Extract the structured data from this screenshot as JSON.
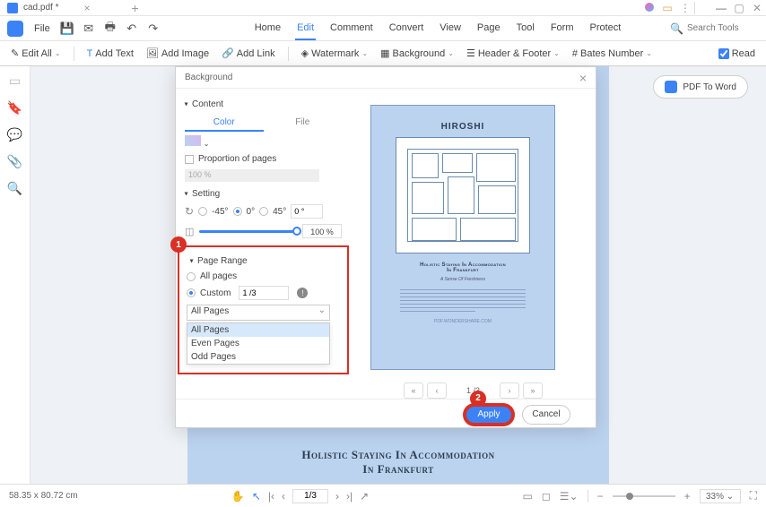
{
  "titlebar": {
    "tab_name": "cad.pdf *"
  },
  "menubar": {
    "file": "File",
    "items": [
      "Home",
      "Edit",
      "Comment",
      "Convert",
      "View",
      "Page",
      "Tool",
      "Form",
      "Protect"
    ],
    "active_index": 1,
    "search_placeholder": "Search Tools"
  },
  "toolbar": {
    "edit_all": "Edit All",
    "add_text": "Add Text",
    "add_image": "Add Image",
    "add_link": "Add Link",
    "watermark": "Watermark",
    "background": "Background",
    "header_footer": "Header & Footer",
    "bates_number": "Bates Number",
    "read": "Read"
  },
  "pdf_to_word": "PDF To Word",
  "dialog": {
    "title": "Background",
    "content": {
      "header": "Content",
      "color_tab": "Color",
      "file_tab": "File",
      "proportion_label": "Proportion of pages",
      "proportion_value": "100 %"
    },
    "setting": {
      "header": "Setting",
      "neg45": "-45°",
      "zero": "0°",
      "pos45": "45°",
      "angle_value": "0 °",
      "opacity_value": "100 %"
    },
    "page_range": {
      "header": "Page Range",
      "all_pages": "All pages",
      "custom": "Custom",
      "custom_value": "1 /3",
      "dropdown_selected": "All Pages",
      "options": [
        "All Pages",
        "Even Pages",
        "Odd Pages"
      ]
    },
    "preview": {
      "title": "HIROSHI",
      "subtitle1": "Holistic Staying In Accommodation",
      "subtitle2": "In Frankfurt",
      "tagline": "A Sense Of Freshness",
      "url": "PDF.WONDERSHARE.COM",
      "page_indicator": "1 /3"
    },
    "callouts": {
      "one": "1",
      "two": "2"
    },
    "apply": "Apply",
    "cancel": "Cancel"
  },
  "page": {
    "title1": "Holistic Staying In Accommodation",
    "title2": "In Frankfurt"
  },
  "statusbar": {
    "dimensions": "58.35 x 80.72 cm",
    "page": "1/3",
    "zoom": "33%  ⌄"
  }
}
